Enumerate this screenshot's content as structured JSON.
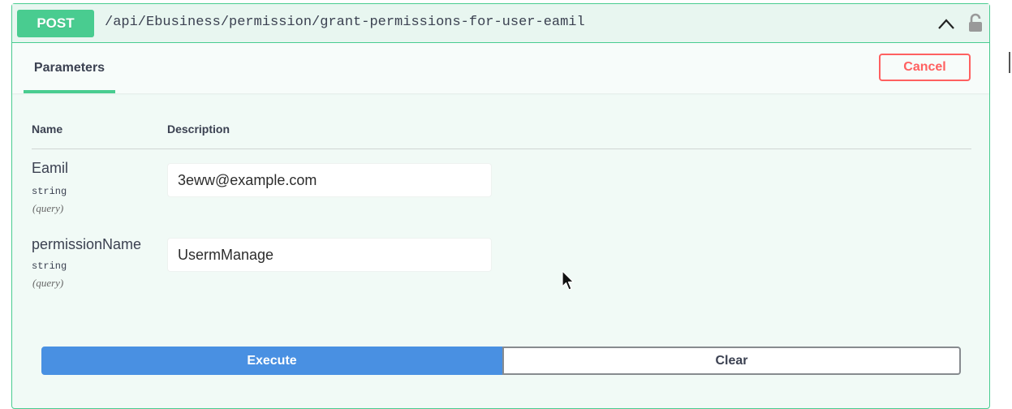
{
  "operation": {
    "method": "POST",
    "path": "/api/Ebusiness/permission/grant-permissions-for-user-eamil",
    "icons": {
      "collapse": "chevron-up-icon",
      "auth": "lock-icon"
    }
  },
  "tabs": {
    "parameters_label": "Parameters"
  },
  "actions": {
    "cancel_label": "Cancel",
    "execute_label": "Execute",
    "clear_label": "Clear"
  },
  "table": {
    "headers": {
      "name": "Name",
      "description": "Description"
    },
    "params": [
      {
        "name": "Eamil",
        "type": "string",
        "in": "(query)",
        "value": "3eww@example.com"
      },
      {
        "name": "permissionName",
        "type": "string",
        "in": "(query)",
        "value": "UsermManage"
      }
    ]
  },
  "colors": {
    "post_accent": "#49cc90",
    "execute_blue": "#4990e2",
    "cancel_red": "#ff6060",
    "text": "#3b4151"
  }
}
